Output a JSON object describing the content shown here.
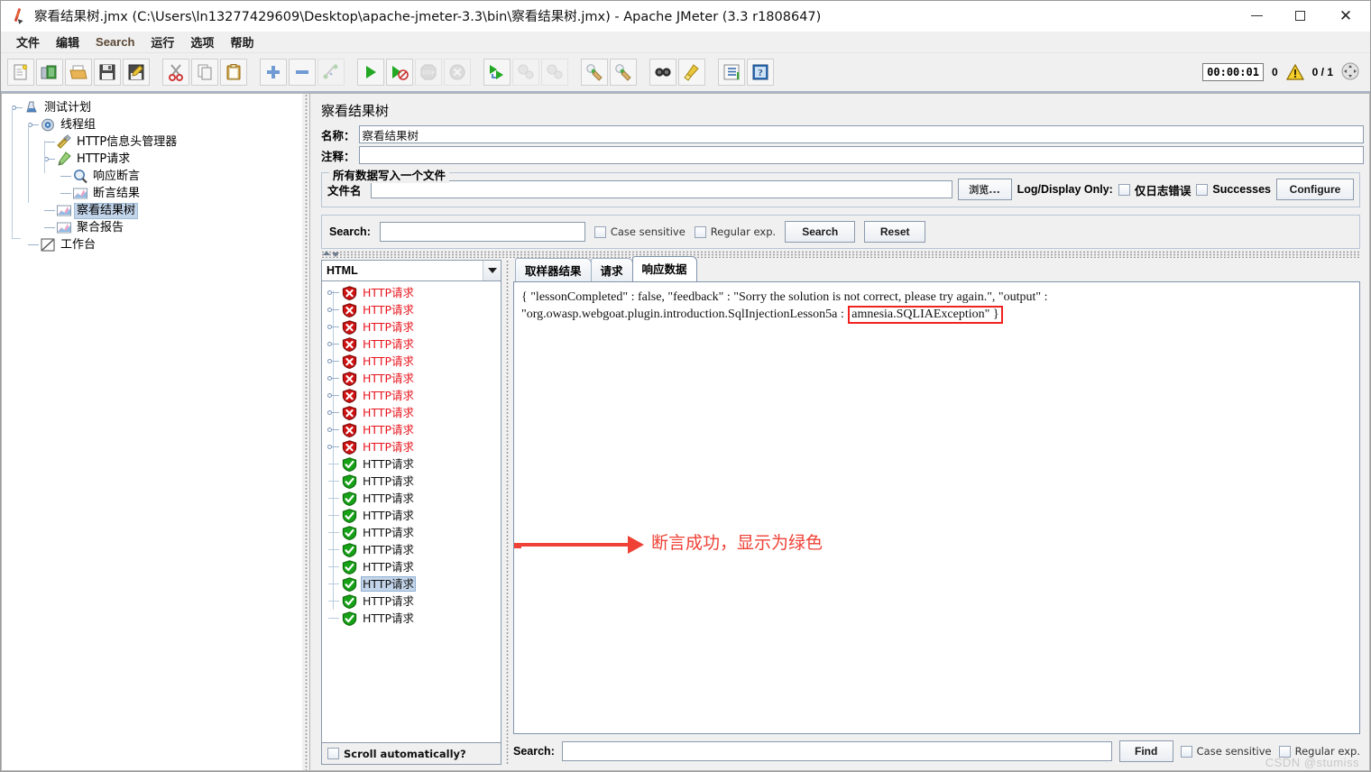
{
  "window": {
    "title": "察看结果树.jmx (C:\\Users\\ln13277429609\\Desktop\\apache-jmeter-3.3\\bin\\察看结果树.jmx) - Apache JMeter (3.3 r1808647)",
    "app_icon": "jmeter-pen-icon",
    "minimize": "minimize-icon",
    "maximize": "maximize-icon",
    "close": "close-icon"
  },
  "menubar": {
    "items": [
      {
        "label": "文件",
        "latin": false
      },
      {
        "label": "编辑",
        "latin": false
      },
      {
        "label": "Search",
        "latin": true
      },
      {
        "label": "运行",
        "latin": false
      },
      {
        "label": "选项",
        "latin": false
      },
      {
        "label": "帮助",
        "latin": false
      }
    ]
  },
  "toolbar": {
    "buttons": [
      "new-icon",
      "templates-icon",
      "open-icon",
      "save-icon",
      "save-as-icon",
      "cut-icon",
      "copy-icon",
      "paste-icon",
      "expand-all-icon",
      "collapse-all-icon",
      "toggle-icon",
      "start-icon",
      "start-no-pauses-icon",
      "stop-icon",
      "shutdown-icon",
      "remote-start-all-icon",
      "remote-stop-all-icon",
      "remote-shutdown-all-icon",
      "clear-icon",
      "clear-all-icon",
      "search-icon",
      "search-reset-icon",
      "function-helper-icon",
      "help-icon"
    ],
    "status": {
      "timer": "00:00:01",
      "error_count": "0",
      "warn_icon": "warning-triangle-icon",
      "threads": "0 / 1",
      "expand_icon": "expand-controls-icon"
    }
  },
  "tree": {
    "nodes": [
      {
        "label": "测试计划",
        "icon": "test-plan-icon",
        "depth": 0,
        "expandable": true,
        "selected": false
      },
      {
        "label": "线程组",
        "icon": "thread-group-icon",
        "depth": 1,
        "expandable": true,
        "selected": false
      },
      {
        "label": "HTTP信息头管理器",
        "icon": "header-manager-icon",
        "depth": 2,
        "expandable": false,
        "selected": false
      },
      {
        "label": "HTTP请求",
        "icon": "http-request-icon",
        "depth": 2,
        "expandable": true,
        "selected": false
      },
      {
        "label": "响应断言",
        "icon": "response-assertion-icon",
        "depth": 3,
        "expandable": false,
        "selected": false
      },
      {
        "label": "断言结果",
        "icon": "assertion-results-icon",
        "depth": 3,
        "expandable": false,
        "selected": false
      },
      {
        "label": "察看结果树",
        "icon": "view-results-tree-icon",
        "depth": 2,
        "expandable": false,
        "selected": true
      },
      {
        "label": "聚合报告",
        "icon": "aggregate-report-icon",
        "depth": 2,
        "expandable": false,
        "selected": false
      },
      {
        "label": "工作台",
        "icon": "workbench-icon",
        "depth": 0,
        "expandable": false,
        "selected": false
      }
    ]
  },
  "panel": {
    "title": "察看结果树",
    "name_label": "名称：",
    "name_value": "察看结果树",
    "comment_label": "注释：",
    "comment_value": "",
    "file_group_legend": "所有数据写入一个文件",
    "filename_label": "文件名",
    "filename_value": "",
    "browse_button": "浏览...",
    "log_display_label": "Log/Display Only:",
    "errors_only_checkbox": "仅日志错误",
    "successes_checkbox": "Successes",
    "configure_button": "Configure"
  },
  "search_bar": {
    "label": "Search:",
    "value": "",
    "case_sensitive": "Case sensitive",
    "regular_exp": "Regular exp.",
    "search_button": "Search",
    "reset_button": "Reset"
  },
  "results": {
    "renderer_selected": "HTML",
    "scroll_automatically": "Scroll automatically?",
    "rows": [
      {
        "label": "HTTP请求",
        "status": "error",
        "selected": false
      },
      {
        "label": "HTTP请求",
        "status": "error",
        "selected": false
      },
      {
        "label": "HTTP请求",
        "status": "error",
        "selected": false
      },
      {
        "label": "HTTP请求",
        "status": "error",
        "selected": false
      },
      {
        "label": "HTTP请求",
        "status": "error",
        "selected": false
      },
      {
        "label": "HTTP请求",
        "status": "error",
        "selected": false
      },
      {
        "label": "HTTP请求",
        "status": "error",
        "selected": false
      },
      {
        "label": "HTTP请求",
        "status": "error",
        "selected": false
      },
      {
        "label": "HTTP请求",
        "status": "error",
        "selected": false
      },
      {
        "label": "HTTP请求",
        "status": "error",
        "selected": false
      },
      {
        "label": "HTTP请求",
        "status": "success",
        "selected": false
      },
      {
        "label": "HTTP请求",
        "status": "success",
        "selected": false
      },
      {
        "label": "HTTP请求",
        "status": "success",
        "selected": false
      },
      {
        "label": "HTTP请求",
        "status": "success",
        "selected": false
      },
      {
        "label": "HTTP请求",
        "status": "success",
        "selected": false
      },
      {
        "label": "HTTP请求",
        "status": "success",
        "selected": false
      },
      {
        "label": "HTTP请求",
        "status": "success",
        "selected": false
      },
      {
        "label": "HTTP请求",
        "status": "success",
        "selected": true
      },
      {
        "label": "HTTP请求",
        "status": "success",
        "selected": false
      },
      {
        "label": "HTTP请求",
        "status": "success",
        "selected": false
      }
    ]
  },
  "response": {
    "tabs": [
      {
        "label": "取样器结果",
        "active": false
      },
      {
        "label": "请求",
        "active": false
      },
      {
        "label": "响应数据",
        "active": true
      }
    ],
    "body_before": "{ \"lessonCompleted\" : false, \"feedback\" : \"Sorry the solution is not correct, please try again.\", \"output\" : \"org.owasp.webgoat.plugin.introduction.SqlInjectionLesson5a : ",
    "body_highlight": "amnesia.SQLIAException\" }",
    "highlight_color": "#f0221f"
  },
  "annotation": {
    "text": "断言成功，显示为绿色",
    "color": "#ef4136"
  },
  "bottom_search": {
    "label": "Search:",
    "value": "",
    "find_button": "Find",
    "case_sensitive": "Case sensitive",
    "regular_exp": "Regular exp."
  },
  "watermark": "CSDN @stumiss",
  "colors": {
    "error_red": "#e8141d",
    "success_green": "#18a020",
    "selection_blue": "#c3d5ea",
    "accent": "#ef4136"
  }
}
